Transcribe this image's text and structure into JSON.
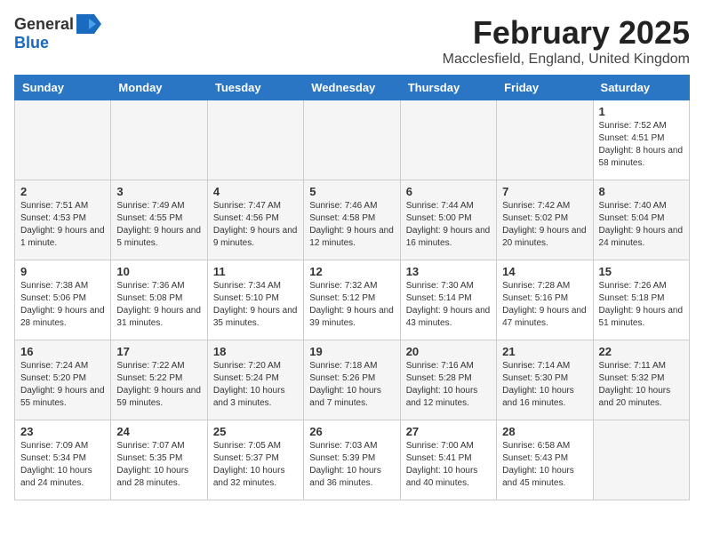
{
  "header": {
    "logo_general": "General",
    "logo_blue": "Blue",
    "title": "February 2025",
    "subtitle": "Macclesfield, England, United Kingdom"
  },
  "days_of_week": [
    "Sunday",
    "Monday",
    "Tuesday",
    "Wednesday",
    "Thursday",
    "Friday",
    "Saturday"
  ],
  "weeks": [
    {
      "days": [
        {
          "date": "",
          "info": ""
        },
        {
          "date": "",
          "info": ""
        },
        {
          "date": "",
          "info": ""
        },
        {
          "date": "",
          "info": ""
        },
        {
          "date": "",
          "info": ""
        },
        {
          "date": "",
          "info": ""
        },
        {
          "date": "1",
          "info": "Sunrise: 7:52 AM\nSunset: 4:51 PM\nDaylight: 8 hours and 58 minutes."
        }
      ]
    },
    {
      "days": [
        {
          "date": "2",
          "info": "Sunrise: 7:51 AM\nSunset: 4:53 PM\nDaylight: 9 hours and 1 minute."
        },
        {
          "date": "3",
          "info": "Sunrise: 7:49 AM\nSunset: 4:55 PM\nDaylight: 9 hours and 5 minutes."
        },
        {
          "date": "4",
          "info": "Sunrise: 7:47 AM\nSunset: 4:56 PM\nDaylight: 9 hours and 9 minutes."
        },
        {
          "date": "5",
          "info": "Sunrise: 7:46 AM\nSunset: 4:58 PM\nDaylight: 9 hours and 12 minutes."
        },
        {
          "date": "6",
          "info": "Sunrise: 7:44 AM\nSunset: 5:00 PM\nDaylight: 9 hours and 16 minutes."
        },
        {
          "date": "7",
          "info": "Sunrise: 7:42 AM\nSunset: 5:02 PM\nDaylight: 9 hours and 20 minutes."
        },
        {
          "date": "8",
          "info": "Sunrise: 7:40 AM\nSunset: 5:04 PM\nDaylight: 9 hours and 24 minutes."
        }
      ]
    },
    {
      "days": [
        {
          "date": "9",
          "info": "Sunrise: 7:38 AM\nSunset: 5:06 PM\nDaylight: 9 hours and 28 minutes."
        },
        {
          "date": "10",
          "info": "Sunrise: 7:36 AM\nSunset: 5:08 PM\nDaylight: 9 hours and 31 minutes."
        },
        {
          "date": "11",
          "info": "Sunrise: 7:34 AM\nSunset: 5:10 PM\nDaylight: 9 hours and 35 minutes."
        },
        {
          "date": "12",
          "info": "Sunrise: 7:32 AM\nSunset: 5:12 PM\nDaylight: 9 hours and 39 minutes."
        },
        {
          "date": "13",
          "info": "Sunrise: 7:30 AM\nSunset: 5:14 PM\nDaylight: 9 hours and 43 minutes."
        },
        {
          "date": "14",
          "info": "Sunrise: 7:28 AM\nSunset: 5:16 PM\nDaylight: 9 hours and 47 minutes."
        },
        {
          "date": "15",
          "info": "Sunrise: 7:26 AM\nSunset: 5:18 PM\nDaylight: 9 hours and 51 minutes."
        }
      ]
    },
    {
      "days": [
        {
          "date": "16",
          "info": "Sunrise: 7:24 AM\nSunset: 5:20 PM\nDaylight: 9 hours and 55 minutes."
        },
        {
          "date": "17",
          "info": "Sunrise: 7:22 AM\nSunset: 5:22 PM\nDaylight: 9 hours and 59 minutes."
        },
        {
          "date": "18",
          "info": "Sunrise: 7:20 AM\nSunset: 5:24 PM\nDaylight: 10 hours and 3 minutes."
        },
        {
          "date": "19",
          "info": "Sunrise: 7:18 AM\nSunset: 5:26 PM\nDaylight: 10 hours and 7 minutes."
        },
        {
          "date": "20",
          "info": "Sunrise: 7:16 AM\nSunset: 5:28 PM\nDaylight: 10 hours and 12 minutes."
        },
        {
          "date": "21",
          "info": "Sunrise: 7:14 AM\nSunset: 5:30 PM\nDaylight: 10 hours and 16 minutes."
        },
        {
          "date": "22",
          "info": "Sunrise: 7:11 AM\nSunset: 5:32 PM\nDaylight: 10 hours and 20 minutes."
        }
      ]
    },
    {
      "days": [
        {
          "date": "23",
          "info": "Sunrise: 7:09 AM\nSunset: 5:34 PM\nDaylight: 10 hours and 24 minutes."
        },
        {
          "date": "24",
          "info": "Sunrise: 7:07 AM\nSunset: 5:35 PM\nDaylight: 10 hours and 28 minutes."
        },
        {
          "date": "25",
          "info": "Sunrise: 7:05 AM\nSunset: 5:37 PM\nDaylight: 10 hours and 32 minutes."
        },
        {
          "date": "26",
          "info": "Sunrise: 7:03 AM\nSunset: 5:39 PM\nDaylight: 10 hours and 36 minutes."
        },
        {
          "date": "27",
          "info": "Sunrise: 7:00 AM\nSunset: 5:41 PM\nDaylight: 10 hours and 40 minutes."
        },
        {
          "date": "28",
          "info": "Sunrise: 6:58 AM\nSunset: 5:43 PM\nDaylight: 10 hours and 45 minutes."
        },
        {
          "date": "",
          "info": ""
        }
      ]
    }
  ]
}
